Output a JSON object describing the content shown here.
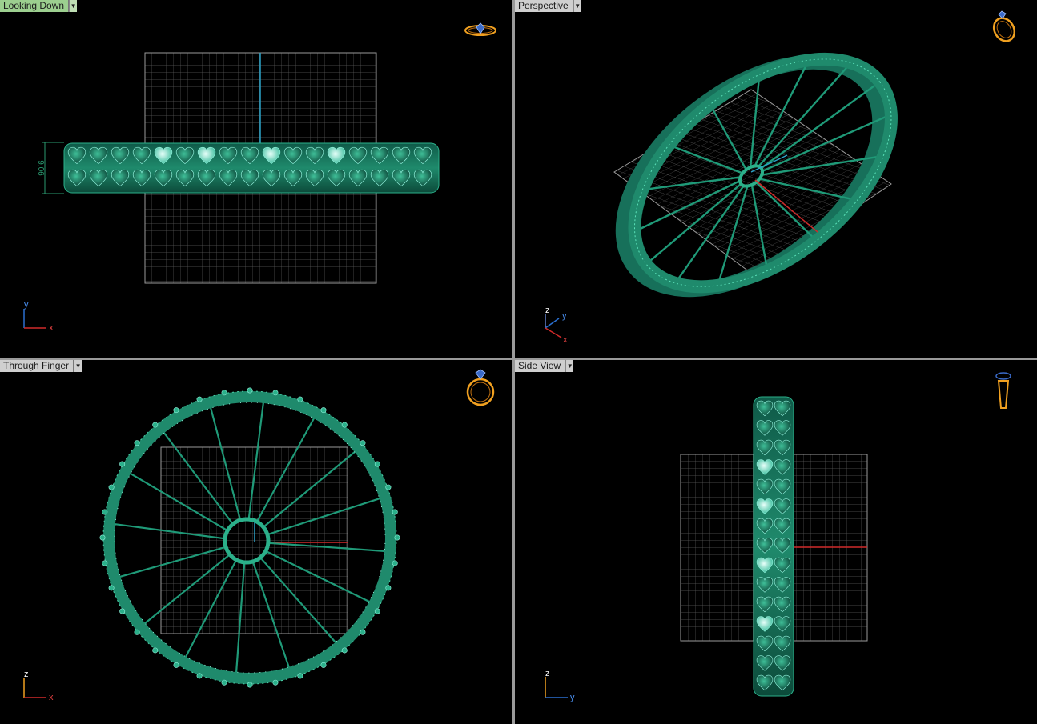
{
  "viewports": {
    "top": {
      "label": "Looking Down",
      "dimension": "9.06",
      "axis_a": "y",
      "axis_b": "x",
      "active": true
    },
    "perspective": {
      "label": "Perspective",
      "axis_a": "z",
      "axis_b": "y",
      "axis_c": "x"
    },
    "front": {
      "label": "Through Finger",
      "axis_a": "z",
      "axis_b": "x"
    },
    "side": {
      "label": "Side View",
      "axis_a": "z",
      "axis_b": "y"
    }
  },
  "colors": {
    "ring_green": "#1f8a6c",
    "highlight": "#8ff0da",
    "grid": "#8c8c8c",
    "axis_x": "#d02a2a",
    "axis_y": "#2a6fd0",
    "icon_orange": "#f0a020",
    "label_active": "#9ccf8f",
    "label_inactive": "#cfcfcf"
  },
  "icons": [
    "dropdown-arrow-icon",
    "ring-orientation-icon",
    "axis-gizmo-icon"
  ]
}
